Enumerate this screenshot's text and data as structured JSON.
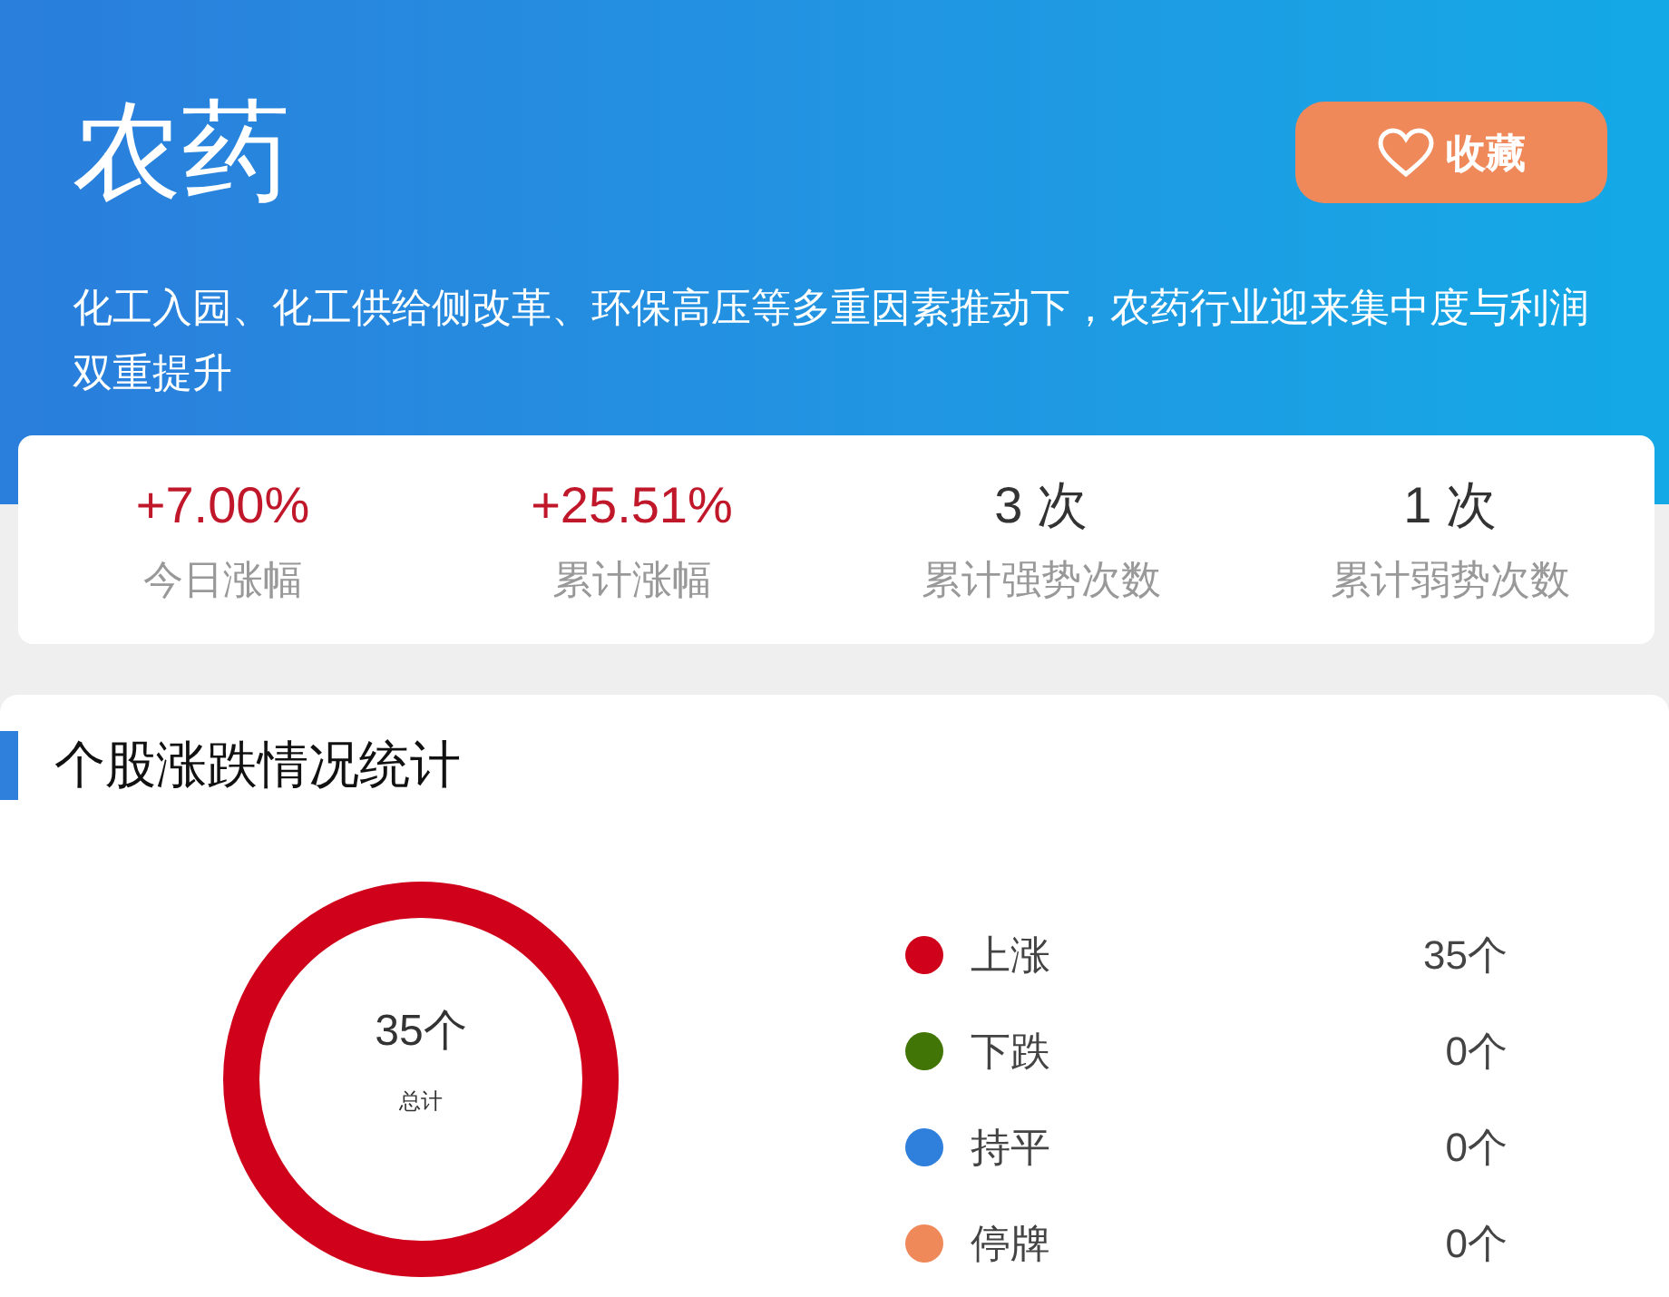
{
  "header": {
    "title": "农药",
    "favorite_button": "收藏",
    "description": "化工入园、化工供给侧改革、环保高压等多重因素推动下，农药行业迎来集中度与利润双重提升"
  },
  "stats": [
    {
      "value": "+7.00%",
      "label": "今日涨幅",
      "color": "#c0182a"
    },
    {
      "value": "+25.51%",
      "label": "累计涨幅",
      "color": "#c0182a"
    },
    {
      "value": "3 次",
      "label": "累计强势次数",
      "color": "#333333"
    },
    {
      "value": "1 次",
      "label": "累计弱势次数",
      "color": "#333333"
    }
  ],
  "section": {
    "title": "个股涨跌情况统计",
    "donut": {
      "center_value": "35个",
      "center_label": "总计"
    },
    "legend": [
      {
        "label": "上涨",
        "count": "35个",
        "color": "#d0021b"
      },
      {
        "label": "下跌",
        "count": "0个",
        "color": "#417505"
      },
      {
        "label": "持平",
        "count": "0个",
        "color": "#2f7fdc"
      },
      {
        "label": "停牌",
        "count": "0个",
        "color": "#f0895a"
      }
    ]
  }
}
